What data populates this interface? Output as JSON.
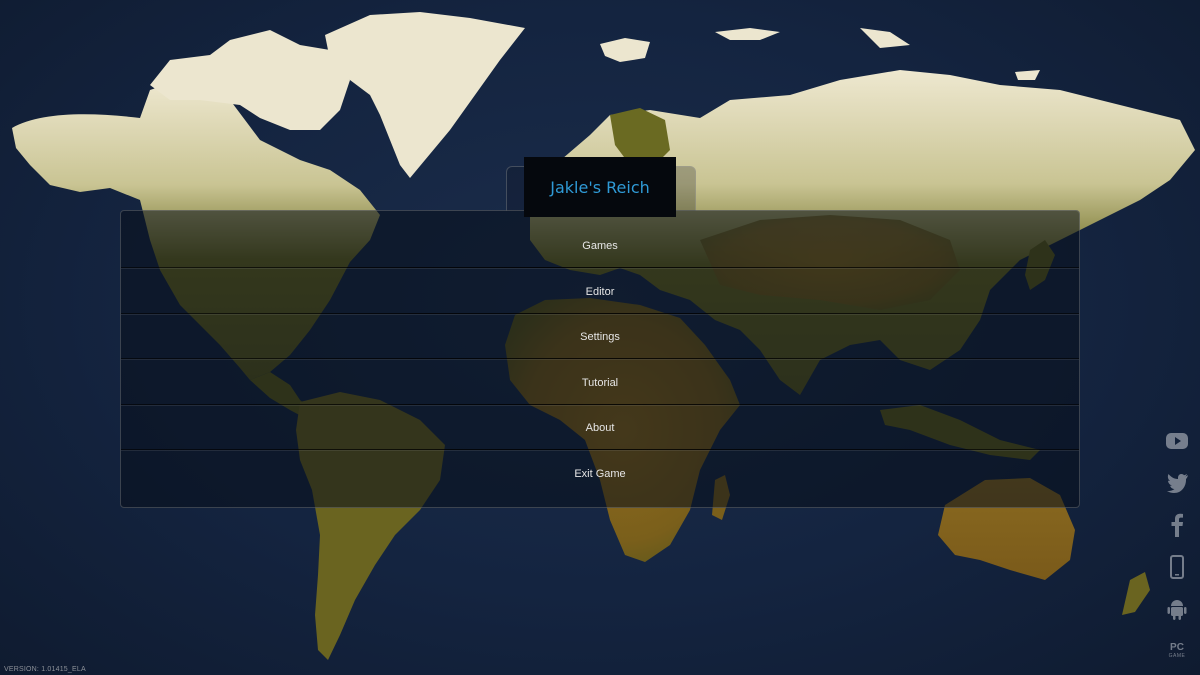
{
  "title": "Jakle's Reich",
  "menu": {
    "items": [
      {
        "id": "games",
        "label": "Games"
      },
      {
        "id": "editor",
        "label": "Editor"
      },
      {
        "id": "settings",
        "label": "Settings"
      },
      {
        "id": "tutorial",
        "label": "Tutorial"
      },
      {
        "id": "about",
        "label": "About"
      },
      {
        "id": "exit",
        "label": "Exit Game"
      }
    ]
  },
  "version": "VERSION: 1.01415_ELA",
  "social": {
    "icons": [
      "youtube-icon",
      "twitter-icon",
      "facebook-icon",
      "mobile-phone-icon",
      "android-icon",
      "pc-game-icon"
    ],
    "pc_label": "PC",
    "game_label": "GAME"
  },
  "colors": {
    "ocean": "#14223a",
    "title_text": "#2f9ad6",
    "menu_text": "#e6e6e6",
    "ice": "#ece6cf",
    "land_green": "#5d5e1c",
    "land_desert": "#8b6a1c"
  }
}
